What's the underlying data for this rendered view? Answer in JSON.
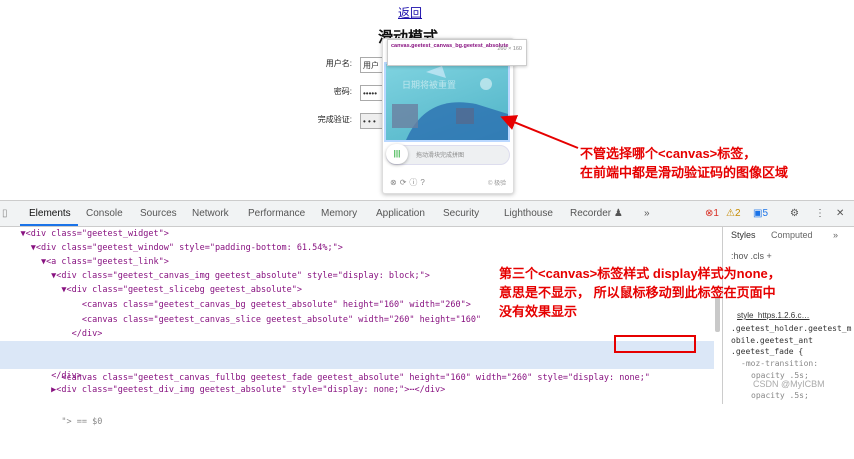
{
  "page": {
    "back_link": "返回",
    "title": "滑动模式",
    "username_label": "用户名:",
    "username_value": "用户",
    "password_label": "密码:",
    "password_value": "•••••",
    "captcha_label": "完成验证:",
    "captcha_placeholder": "• • •"
  },
  "captcha": {
    "tooltip_class": "canvas.geetest_canvas_bg.geetest_absolute",
    "tooltip_size": "260 × 160",
    "image_text": "日期将被重置",
    "slider_text": "拖动滑块完成拼图",
    "brand": "© 极验"
  },
  "annotations": {
    "top_line1": "不管选择哪个<canvas>标签，",
    "top_line2": "在前端中都是滑动验证码的图像区域",
    "bottom_line1": "第三个<canvas>标签样式 display样式为none，",
    "bottom_line2": "意思是不显示， 所以鼠标移动到此标签在页面中",
    "bottom_line3": "没有效果显示"
  },
  "devtools": {
    "tabs": [
      "Elements",
      "Console",
      "Sources",
      "Network",
      "Performance",
      "Memory",
      "Application",
      "Security",
      "Lighthouse",
      "Recorder ♟",
      "»"
    ],
    "errors": "1",
    "warnings": "2",
    "info": "5",
    "lines": [
      {
        "indent": "    ▼",
        "text": "<div class=\"geetest_widget\">"
      },
      {
        "indent": "      ▼",
        "text": "<div class=\"geetest_window\" style=\"padding-bottom: 61.54%;\">"
      },
      {
        "indent": "        ▼",
        "text": "<a class=\"geetest_link\">"
      },
      {
        "indent": "          ▼",
        "text": "<div class=\"geetest_canvas_img geetest_absolute\" style=\"display: block;\">"
      },
      {
        "indent": "            ▼",
        "text": "<div class=\"geetest_slicebg geetest_absolute\">"
      },
      {
        "indent": "                ",
        "text": "<canvas class=\"geetest_canvas_bg geetest_absolute\" height=\"160\" width=\"260\">"
      },
      {
        "indent": "                ",
        "text": "<canvas class=\"geetest_canvas_slice geetest_absolute\" width=\"260\" height=\"160\""
      },
      {
        "indent": "              ",
        "text": "</div>"
      },
      {
        "indent": "            ",
        "text": "<canvas class=\"geetest_canvas_fullbg geetest_fade geetest_absolute\" height=\"160\" width=\"260\" style=\"display: none;\""
      },
      {
        "indent": "            ",
        "text": "\"> == $0"
      },
      {
        "indent": "          ",
        "text": "</div>"
      },
      {
        "indent": "          ▶",
        "text": "<div class=\"geetest_div_img geetest_absolute\" style=\"display: none;\">⋯</div>"
      }
    ],
    "styles": {
      "tabs": [
        "Styles",
        "Computed",
        "»"
      ],
      "filter": ":hov  .cls  +",
      "file": "style_https.1.2.6.c…",
      "rule1": ".geetest_holder.geetest_mobile.geetest_ant",
      "rule2": ".geetest_fade {",
      "prop1": "-moz-transition:",
      "prop2": "opacity .5s;",
      "prop3": "opacity .5s;"
    },
    "watermark": "CSDN @MyICBM"
  },
  "colors": {
    "accent_red": "#e60000",
    "selection": "#dbe7f7",
    "tag": "#881280"
  }
}
